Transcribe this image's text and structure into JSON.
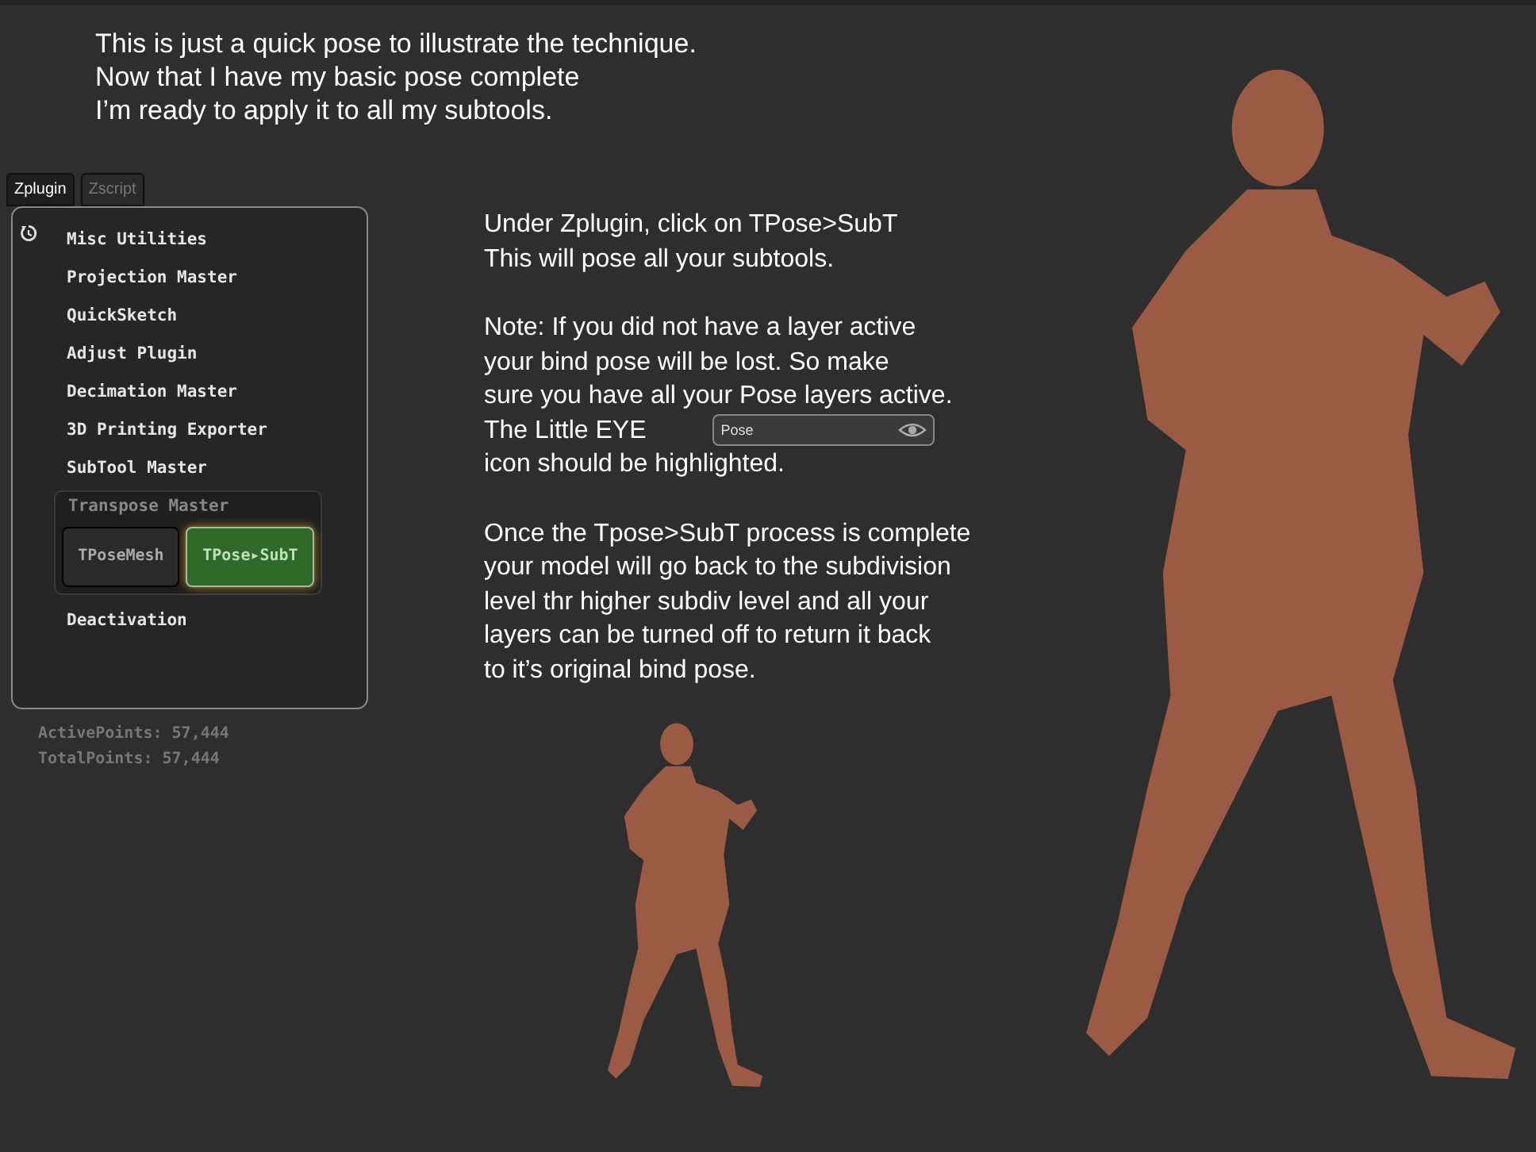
{
  "caption": [
    "This is just a quick pose to illustrate the technique.",
    "Now that I have my basic pose complete",
    "I’m ready to apply it to all my subtools."
  ],
  "tabs": [
    {
      "label": "Zplugin",
      "selected": true
    },
    {
      "label": "Zscript",
      "selected": false
    }
  ],
  "status": [
    "ActivePoints: 57,444",
    "TotalPoints: 57,444"
  ],
  "menu": {
    "items": [
      {
        "kind": "item",
        "label": "Misc Utilities"
      },
      {
        "kind": "item",
        "label": "Projection Master"
      },
      {
        "kind": "item",
        "label": "QuickSketch"
      },
      {
        "kind": "item",
        "label": "Adjust Plugin"
      },
      {
        "kind": "item",
        "label": "Decimation Master"
      },
      {
        "kind": "item",
        "label": "3D Printing Exporter"
      },
      {
        "kind": "item",
        "label": "SubTool Master"
      },
      {
        "kind": "group",
        "label": "Transpose Master",
        "buttons": [
          {
            "label": "TPoseMesh",
            "highlighted": false
          },
          {
            "label": "TPose▸SubT",
            "highlighted": true
          }
        ]
      },
      {
        "kind": "item",
        "label": "Deactivation"
      }
    ]
  },
  "instructions": [
    {
      "lines": [
        {
          "text": "Under Zplugin, click on TPose>SubT"
        },
        {
          "text": " This will pose all your subtools."
        }
      ]
    },
    {
      "lines": [
        {
          "text": "Note: If you did not have a layer active"
        },
        {
          "text": "your bind pose will be lost. So make"
        },
        {
          "text": "sure you have all your Pose layers active."
        },
        {
          "text": "The Little EYE",
          "field": {
            "value": "Pose",
            "eye_on": true
          }
        },
        {
          "text": "icon should be highlighted."
        }
      ]
    },
    {
      "lines": [
        {
          "text": "Once the Tpose>SubT process is complete"
        },
        {
          "text": "your model will go back to the subdivision"
        },
        {
          "text": "level thr higher subdiv level and all your"
        },
        {
          "text": "layers can be turned off to return it back"
        },
        {
          "text": "to it’s original bind pose."
        }
      ]
    }
  ]
}
